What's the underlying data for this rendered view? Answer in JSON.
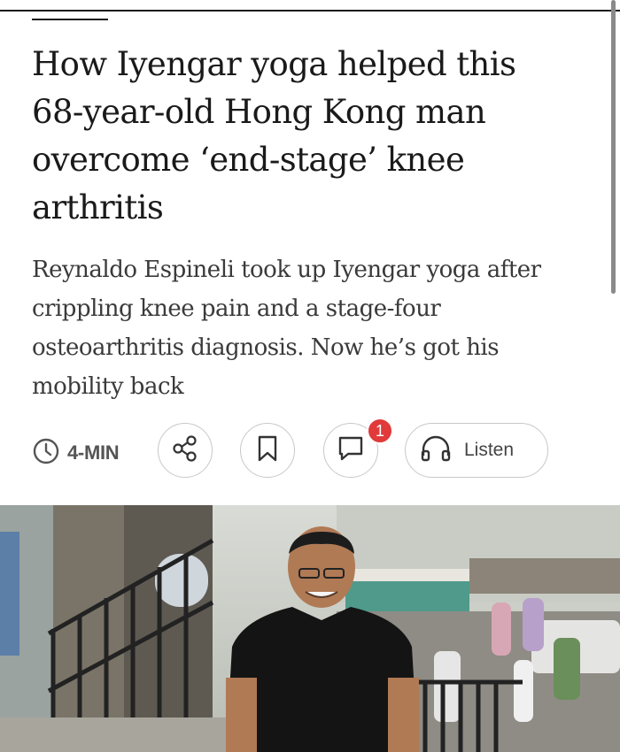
{
  "article": {
    "headline_lines": [
      "How Iyengar yoga helped this",
      "68-year-old Hong Kong man",
      "overcome ‘end-stage’ knee",
      "arthritis"
    ],
    "standfirst_lines": [
      "Reynaldo Espineli took up Iyengar yoga after",
      "crippling knee pain and a stage-four",
      "osteoarthritis diagnosis. Now he’s got his",
      "mobility back"
    ]
  },
  "actions": {
    "read_time": "4-MIN",
    "comment_count": "1",
    "listen_label": "Listen",
    "icons": [
      "clock-icon",
      "share-icon",
      "bookmark-icon",
      "comment-icon",
      "headphones-icon"
    ]
  },
  "hero": {
    "description_icon": "photo"
  },
  "colors": {
    "text": "#1a1a1a",
    "standfirst": "#3a3a3a",
    "badge": "#e03a3a",
    "border": "#c8c8c8"
  }
}
